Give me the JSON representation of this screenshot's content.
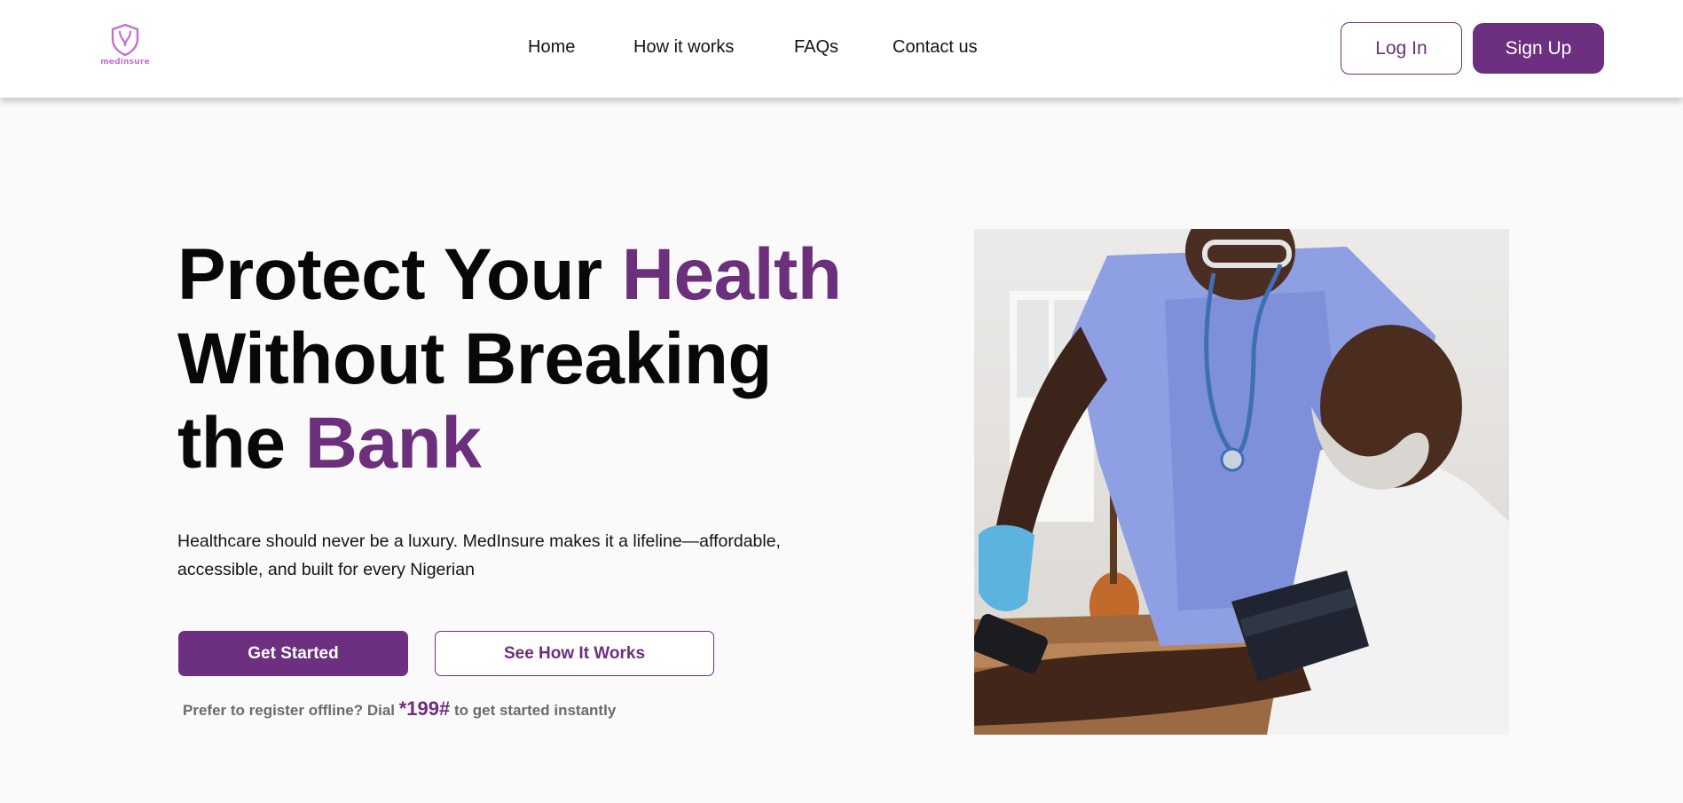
{
  "brand": {
    "logo_text": "medinsure",
    "logo_icon": "shield-icon",
    "accent_color": "#6c2f7c"
  },
  "nav": {
    "items": [
      {
        "label": "Home"
      },
      {
        "label": "How it works"
      },
      {
        "label": "FAQs"
      },
      {
        "label": "Contact us"
      }
    ]
  },
  "auth": {
    "login_label": "Log In",
    "signup_label": "Sign Up"
  },
  "hero": {
    "headline_part1": "Protect Your ",
    "headline_accent1": "Health",
    "headline_part2": "Without Breaking",
    "headline_part3": "the ",
    "headline_accent2": "Bank",
    "subtext": "Healthcare should never be a luxury. MedInsure makes it a lifeline—affordable, accessible, and built for every Nigerian",
    "primary_cta": "Get Started",
    "secondary_cta": "See How It Works",
    "offline_prefix": "Prefer to register offline? Dial ",
    "offline_code": "*199#",
    "offline_suffix": " to get started instantly"
  }
}
